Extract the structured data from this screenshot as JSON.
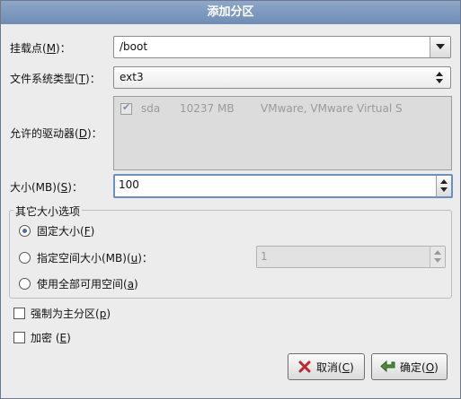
{
  "dialog": {
    "title": "添加分区"
  },
  "mount_point": {
    "label_pre": "挂载点(",
    "mnemonic": "M",
    "label_post": ")：",
    "value": "/boot"
  },
  "fs_type": {
    "label_pre": "文件系统类型(",
    "mnemonic": "T",
    "label_post": ")：",
    "value": "ext3"
  },
  "drives": {
    "label_pre": "允许的驱动器(",
    "mnemonic": "D",
    "label_post": ")：",
    "rows": [
      {
        "checked": true,
        "name": "sda",
        "size": "10237 MB",
        "model": "VMware, VMware Virtual S"
      }
    ]
  },
  "size": {
    "label_pre": "大小(MB)(",
    "mnemonic": "S",
    "label_post": ")：",
    "value": "100"
  },
  "other_size": {
    "title": "其它大小选项",
    "fixed": {
      "label_pre": "固定大小(",
      "mnemonic": "F",
      "label_post": ")",
      "selected": true
    },
    "fill_to": {
      "label_pre": "指定空间大小(MB)(",
      "mnemonic": "u",
      "label_post": ")：",
      "value": "1",
      "selected": false
    },
    "fill_all": {
      "label_pre": "使用全部可用空间(",
      "mnemonic": "a",
      "label_post": ")",
      "selected": false
    }
  },
  "force_primary": {
    "label_pre": "强制为主分区(",
    "mnemonic": "p",
    "label_post": ")",
    "checked": false
  },
  "encrypt": {
    "label_pre": "加密 (",
    "mnemonic": "E",
    "label_post": ")",
    "checked": false
  },
  "buttons": {
    "cancel": {
      "label_pre": "取消(",
      "mnemonic": "C",
      "label_post": ")",
      "icon": "x-icon"
    },
    "ok": {
      "label_pre": "确定(",
      "mnemonic": "O",
      "label_post": ")",
      "icon": "ok-arrow-icon"
    }
  },
  "colors": {
    "title_bar": "#7a95bd",
    "radio_dot": "#4a6fa5",
    "cancel_icon": "#c0262d",
    "ok_icon": "#4f8d3a"
  }
}
